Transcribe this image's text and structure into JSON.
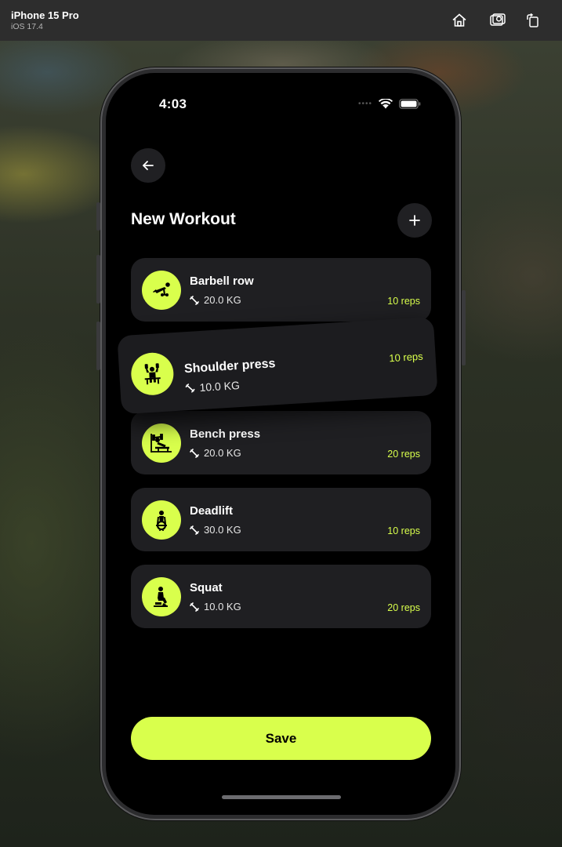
{
  "simulator": {
    "device_name": "iPhone 15 Pro",
    "os_version": "iOS 17.4",
    "buttons": [
      {
        "icon": "home-icon"
      },
      {
        "icon": "screenshot-icon"
      },
      {
        "icon": "rotate-icon"
      }
    ]
  },
  "status_bar": {
    "time": "4:03",
    "icons": [
      "wifi-icon",
      "battery-icon"
    ]
  },
  "header": {
    "back_icon": "arrow-left-icon",
    "title": "New Workout",
    "add_icon": "plus-icon"
  },
  "exercises": [
    {
      "name": "Barbell row",
      "weight": "20.0 KG",
      "reps": "10 reps",
      "icon": "barbell-row-icon"
    },
    {
      "name": "Shoulder press",
      "weight": "10.0 KG",
      "reps": "10 reps",
      "icon": "shoulder-press-icon",
      "state": "dragging"
    },
    {
      "name": "Bench press",
      "weight": "20.0 KG",
      "reps": "20 reps",
      "icon": "bench-press-icon"
    },
    {
      "name": "Deadlift",
      "weight": "30.0 KG",
      "reps": "10 reps",
      "icon": "deadlift-icon"
    },
    {
      "name": "Squat",
      "weight": "10.0 KG",
      "reps": "20 reps",
      "icon": "squat-icon"
    }
  ],
  "actions": {
    "save_label": "Save"
  },
  "colors": {
    "accent": "#d9ff4c",
    "card_background": "#1f1f22",
    "screen_background": "#000000"
  }
}
